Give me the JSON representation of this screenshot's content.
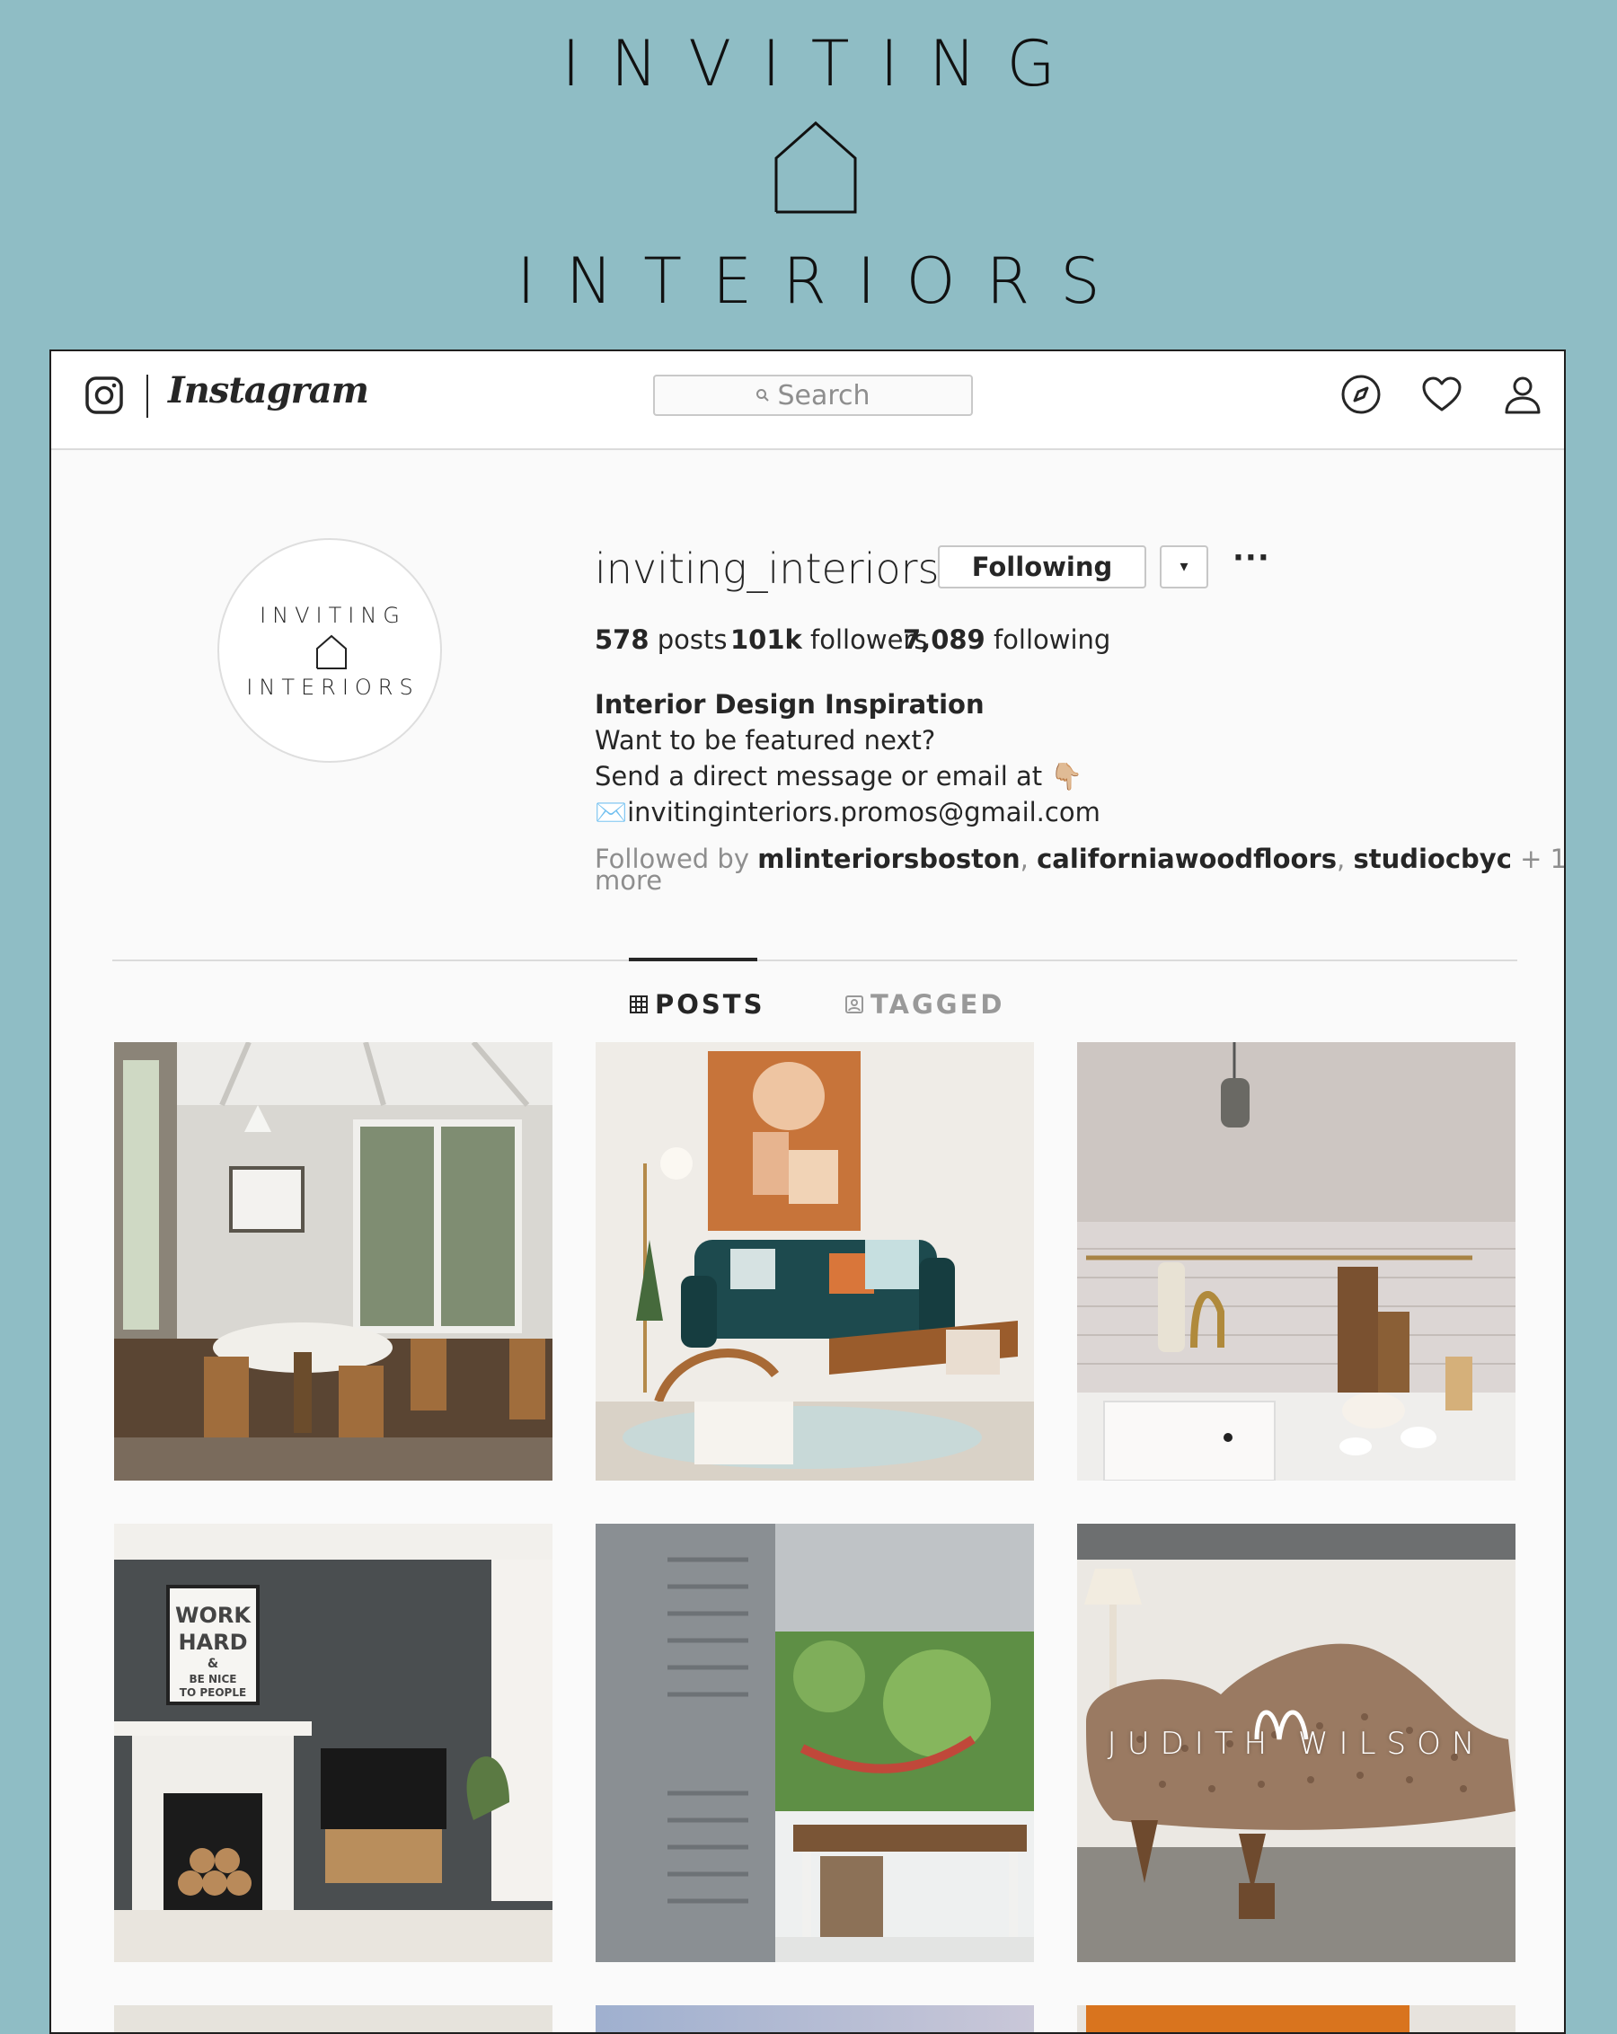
{
  "brand": {
    "top_word": "INVITING",
    "bottom_word": "INTERIORS"
  },
  "topbar": {
    "wordmark": "Instagram",
    "search_placeholder": "Search",
    "icons": [
      "instagram-camera-icon",
      "compass-icon",
      "heart-icon",
      "profile-icon"
    ]
  },
  "profile": {
    "avatar_top": "INVITING",
    "avatar_bottom": "INTERIORS",
    "username": "inviting_interiors",
    "following_button": "Following",
    "dropdown_glyph": "▾",
    "more_glyph": "···",
    "stats": [
      {
        "value": "578",
        "label": "posts"
      },
      {
        "value": "101k",
        "label": "followers"
      },
      {
        "value": "7,089",
        "label": "following"
      }
    ],
    "bio": {
      "name": "Interior Design Inspiration",
      "line1": "Want to be featured next?",
      "line2": "Send a direct message or email at",
      "line2_emoji": "👇🏼",
      "email_emoji": "✉️",
      "email": "invitinginteriors.promos@gmail.com"
    },
    "followed_by": {
      "prefix": "Followed by",
      "users": [
        "mlinteriorsboston",
        "californiawoodfloors",
        "studiocbyc"
      ],
      "suffix": "+ 1 more"
    }
  },
  "tabs": [
    {
      "label": "POSTS",
      "icon": "grid-icon",
      "active": true
    },
    {
      "label": "TAGGED",
      "icon": "tagged-icon",
      "active": false
    }
  ],
  "posts": [
    {
      "subject": "dining-room-photo"
    },
    {
      "subject": "living-room-teal-sofa-photo"
    },
    {
      "subject": "kitchen-brass-faucet-photo"
    },
    {
      "subject": "grey-living-room-fireplace-photo",
      "poster_text": [
        "WORK",
        "HARD",
        "&",
        "BE NICE",
        "TO PEOPLE"
      ]
    },
    {
      "subject": "veranda-hammock-photo"
    },
    {
      "subject": "tufted-chaise-photo",
      "watermark": "JUDITH WILSON"
    },
    {
      "subject": "partial-photo-1"
    },
    {
      "subject": "partial-photo-2"
    },
    {
      "subject": "partial-photo-3"
    }
  ],
  "colors": {
    "background_teal": "#8fbdc5",
    "ig_text": "#262626",
    "ig_muted": "#8e8e8e",
    "ig_border": "#dbdbdb"
  }
}
